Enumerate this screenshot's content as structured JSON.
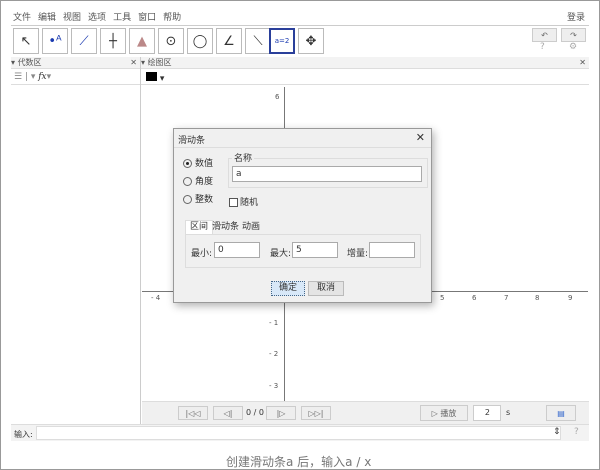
{
  "menu": {
    "items": [
      "文件",
      "编辑",
      "视图",
      "选项",
      "工具",
      "窗口",
      "帮助"
    ],
    "login": "登录"
  },
  "toolbar": {
    "tools": [
      "move-icon",
      "point-icon",
      "line-icon",
      "perpendicular-icon",
      "polygon-icon",
      "circle-icon",
      "conic-icon",
      "angle-icon",
      "reflect-icon",
      "slider-icon",
      "move-view-icon"
    ],
    "selected": "slider-icon",
    "slider_label": "a=2"
  },
  "algebra": {
    "title": "代数区",
    "fx": "fx"
  },
  "graphics": {
    "title": "绘图区",
    "x_ticks": [
      "- 4",
      "5",
      "6",
      "7",
      "8",
      "9"
    ],
    "y_ticks": [
      "6",
      "- 1",
      "- 2",
      "- 3"
    ]
  },
  "dialog": {
    "title": "滑动条",
    "radios": [
      "数值",
      "角度",
      "整数"
    ],
    "selected_radio": 0,
    "name_label": "名称",
    "name_value": "a",
    "random_label": "随机",
    "tabs": [
      "区间",
      "滑动条",
      "动画"
    ],
    "min_label": "最小:",
    "min_value": "0",
    "max_label": "最大:",
    "max_value": "5",
    "step_label": "增量:",
    "step_value": "",
    "ok": "确定",
    "cancel": "取消"
  },
  "playback": {
    "counter": "0 / 0",
    "play": "▷ 播放",
    "speed": "2",
    "unit": "s"
  },
  "input": {
    "label": "输入:",
    "value": ""
  },
  "caption": "创建滑动条a 后，输入a / x"
}
